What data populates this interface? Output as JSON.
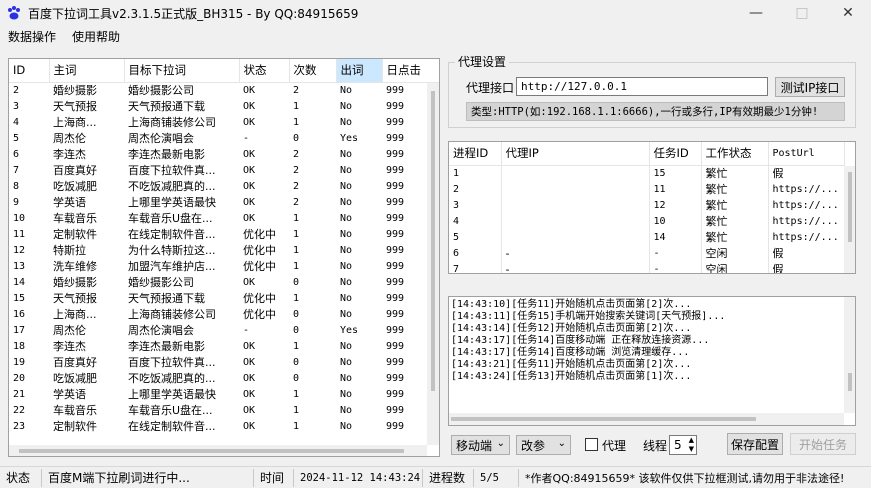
{
  "window": {
    "title": "百度下拉词工具v2.3.1.5正式版_BH315 - By QQ:84915659"
  },
  "menu": [
    "数据操作",
    "使用帮助"
  ],
  "left_table": {
    "headers": [
      "ID",
      "主词",
      "目标下拉词",
      "状态",
      "次数",
      "出词",
      "日点击"
    ],
    "rows": [
      [
        "2",
        "婚纱摄影",
        "婚纱摄影公司",
        "OK",
        "2",
        "No",
        "999"
      ],
      [
        "3",
        "天气预报",
        "天气预报通下载",
        "OK",
        "1",
        "No",
        "999"
      ],
      [
        "4",
        "上海商...",
        "上海商铺装修公司",
        "OK",
        "1",
        "No",
        "999"
      ],
      [
        "5",
        "周杰伦",
        "周杰伦演唱会",
        "-",
        "0",
        "Yes",
        "999"
      ],
      [
        "6",
        "李连杰",
        "李连杰最新电影",
        "OK",
        "2",
        "No",
        "999"
      ],
      [
        "7",
        "百度真好",
        "百度下拉软件真...",
        "OK",
        "2",
        "No",
        "999"
      ],
      [
        "8",
        "吃饭减肥",
        "不吃饭减肥真的...",
        "OK",
        "2",
        "No",
        "999"
      ],
      [
        "9",
        "学英语",
        "上哪里学英语最快",
        "OK",
        "2",
        "No",
        "999"
      ],
      [
        "10",
        "车载音乐",
        "车载音乐U盘在...",
        "OK",
        "1",
        "No",
        "999"
      ],
      [
        "11",
        "定制软件",
        "在线定制软件音...",
        "优化中",
        "1",
        "No",
        "999"
      ],
      [
        "12",
        "特斯拉",
        "为什么特斯拉这...",
        "优化中",
        "1",
        "No",
        "999"
      ],
      [
        "13",
        "洗车维修",
        "加盟汽车维护店...",
        "优化中",
        "1",
        "No",
        "999"
      ],
      [
        "14",
        "婚纱摄影",
        "婚纱摄影公司",
        "OK",
        "0",
        "No",
        "999"
      ],
      [
        "15",
        "天气预报",
        "天气预报通下载",
        "优化中",
        "1",
        "No",
        "999"
      ],
      [
        "16",
        "上海商...",
        "上海商铺装修公司",
        "优化中",
        "0",
        "No",
        "999"
      ],
      [
        "17",
        "周杰伦",
        "周杰伦演唱会",
        "-",
        "0",
        "Yes",
        "999"
      ],
      [
        "18",
        "李连杰",
        "李连杰最新电影",
        "OK",
        "1",
        "No",
        "999"
      ],
      [
        "19",
        "百度真好",
        "百度下拉软件真...",
        "OK",
        "0",
        "No",
        "999"
      ],
      [
        "20",
        "吃饭减肥",
        "不吃饭减肥真的...",
        "OK",
        "0",
        "No",
        "999"
      ],
      [
        "21",
        "学英语",
        "上哪里学英语最快",
        "OK",
        "1",
        "No",
        "999"
      ],
      [
        "22",
        "车载音乐",
        "车载音乐U盘在...",
        "OK",
        "1",
        "No",
        "999"
      ],
      [
        "23",
        "定制软件",
        "在线定制软件音...",
        "OK",
        "1",
        "No",
        "999"
      ]
    ]
  },
  "proxy": {
    "group_title": "代理设置",
    "label": "代理接口",
    "value": "http://127.0.0.1",
    "test_button": "测试IP接口",
    "hint": "类型:HTTP(如:192.168.1.1:6666),一行或多行,IP有效期最少1分钟!"
  },
  "process_table": {
    "headers": [
      "进程ID",
      "代理IP",
      "任务ID",
      "工作状态",
      "PostUrl"
    ],
    "rows": [
      [
        "1",
        "",
        "15",
        "繁忙",
        "假"
      ],
      [
        "2",
        "",
        "11",
        "繁忙",
        "https://..."
      ],
      [
        "3",
        "",
        "12",
        "繁忙",
        "https://..."
      ],
      [
        "4",
        "",
        "10",
        "繁忙",
        "https://..."
      ],
      [
        "5",
        "",
        "14",
        "繁忙",
        "https://..."
      ],
      [
        "6",
        "-",
        "-",
        "空闲",
        "假"
      ],
      [
        "7",
        "-",
        "-",
        "空闲",
        "假"
      ]
    ]
  },
  "log": [
    "[14:43:10][任务11]开始随机点击页面第[2]次...",
    "[14:43:11][任务15]手机端开始搜索关键词[天气预报]...",
    "[14:43:14][任务12]开始随机点击页面第[2]次...",
    "[14:43:17][任务14]百度移动端 正在释放连接资源...",
    "[14:43:17][任务14]百度移动端 浏览清理缓存...",
    "[14:43:21][任务11]开始随机点击页面第[2]次...",
    "[14:43:24][任务13]开始随机点击页面第[1]次..."
  ],
  "controls": {
    "platform": "移动端",
    "mode": "改参",
    "proxy_checkbox": "代理",
    "threads_label": "线程",
    "threads_value": "5",
    "save_button": "保存配置",
    "start_button": "开始任务"
  },
  "status": {
    "state_label": "状态",
    "state_value": "百度M端下拉刷词进行中...",
    "time_label": "时间",
    "time_value": "2024-11-12 14:43:24",
    "progress_label": "进程数",
    "progress_value": "5/5",
    "note": "*作者QQ:84915659* 该软件仅供下拉框测试,请勿用于非法途径!"
  }
}
